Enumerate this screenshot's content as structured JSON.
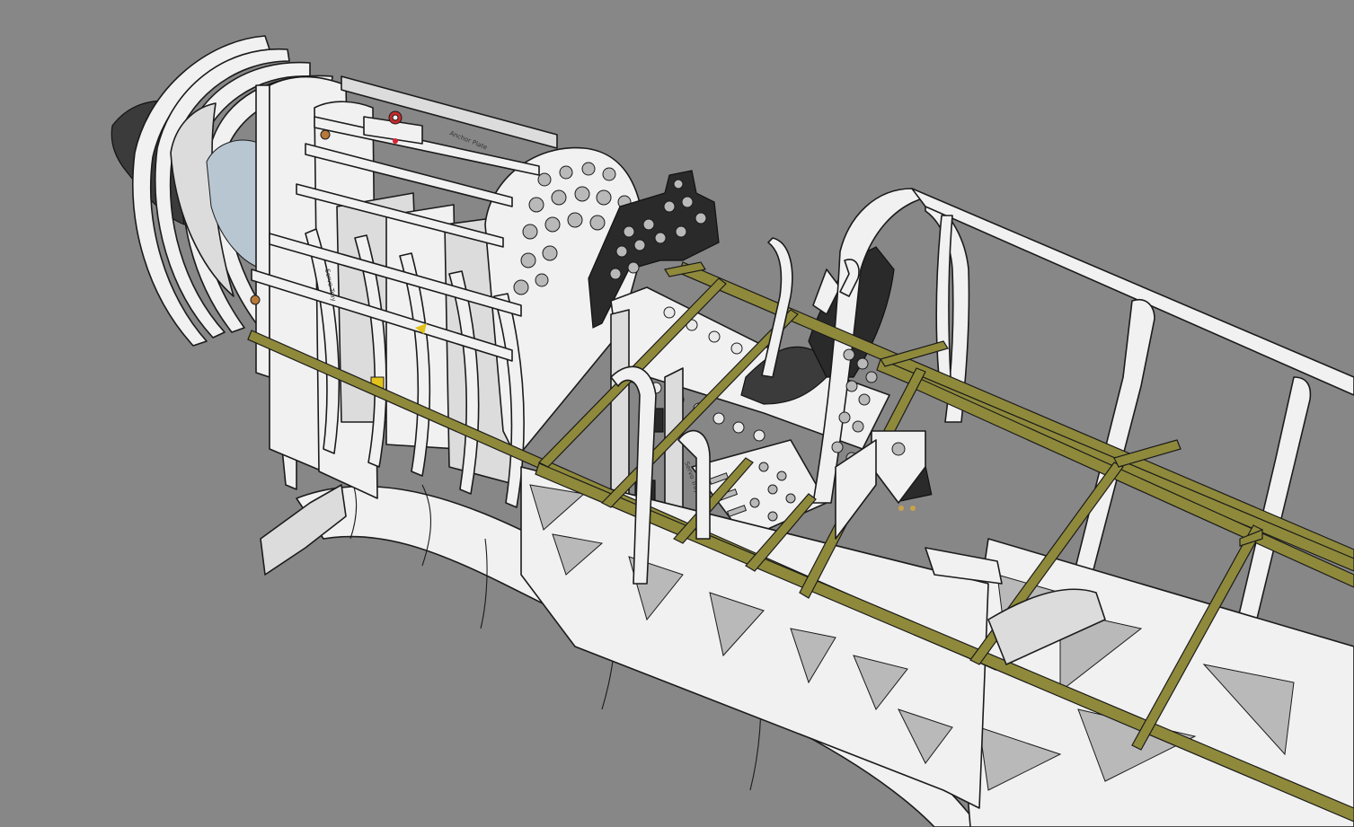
{
  "scene": {
    "subject": "model-airplane-fuselage-frame",
    "colors": {
      "background": "#878787",
      "plywood": "#f1f1f1",
      "plywood_shade": "#dcdcdc",
      "stringer": "#8f8a3b",
      "servo": "#3b3b3b",
      "edge": "#1b1b1b"
    }
  }
}
